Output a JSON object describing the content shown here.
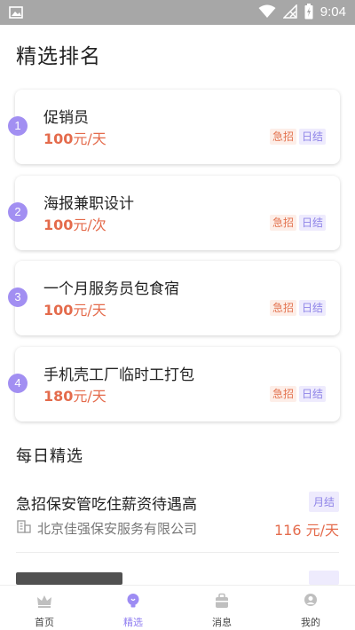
{
  "status_bar": {
    "time": "9:04"
  },
  "page": {
    "title": "精选排名"
  },
  "ranking": [
    {
      "rank": "1",
      "title": "促销员",
      "salary_amount": "100",
      "salary_unit": "元/天",
      "tags": [
        "急招",
        "日结"
      ]
    },
    {
      "rank": "2",
      "title": "海报兼职设计",
      "salary_amount": "100",
      "salary_unit": "元/次",
      "tags": [
        "急招",
        "日结"
      ]
    },
    {
      "rank": "3",
      "title": "一个月服务员包食宿",
      "salary_amount": "100",
      "salary_unit": "元/天",
      "tags": [
        "急招",
        "日结"
      ]
    },
    {
      "rank": "4",
      "title": "手机壳工厂临时工打包",
      "salary_amount": "180",
      "salary_unit": "元/天",
      "tags": [
        "急招",
        "日结"
      ]
    }
  ],
  "daily": {
    "title": "每日精选",
    "items": [
      {
        "title": "急招保安管吃住薪资待遇高",
        "tag": "月结",
        "company": "北京佳强保安服务有限公司",
        "salary_amount": "116",
        "salary_unit": "元/天"
      }
    ]
  },
  "tabbar": {
    "items": [
      {
        "label": "首页",
        "icon": "home-crown-icon",
        "active": false
      },
      {
        "label": "精选",
        "icon": "bulb-icon",
        "active": true
      },
      {
        "label": "消息",
        "icon": "bag-icon",
        "active": false
      },
      {
        "label": "我的",
        "icon": "person-icon",
        "active": false
      }
    ]
  },
  "colors": {
    "accent": "#8f7df0",
    "salary": "#e46b4c",
    "urgent_tag": "#e3734f",
    "daily_tag": "#8f84e8"
  }
}
